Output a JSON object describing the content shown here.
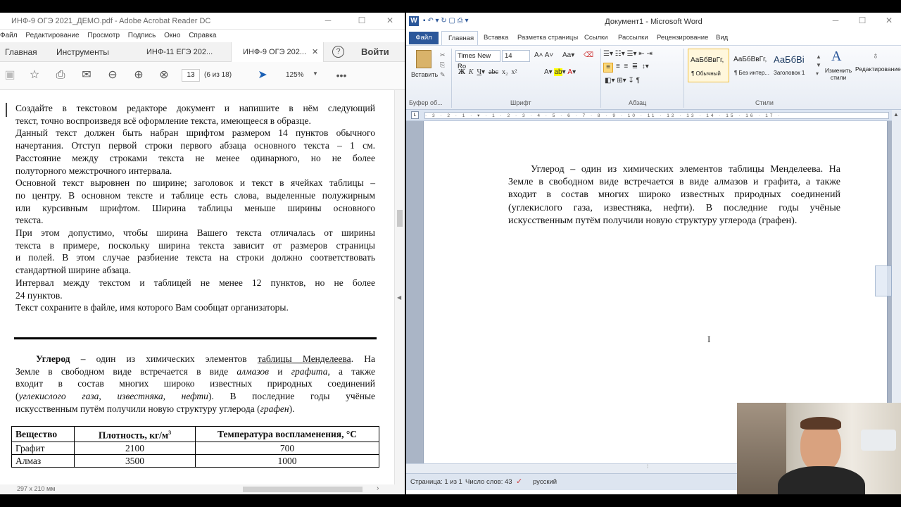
{
  "acrobat": {
    "title": "ИНФ-9 ОГЭ 2021_ДЕМО.pdf - Adobe Acrobat Reader DC",
    "menu": [
      "Файл",
      "Редактирование",
      "Просмотр",
      "Подпись",
      "Окно",
      "Справка"
    ],
    "tabs": {
      "home": "Главная",
      "tools": "Инструменты",
      "tab1": "ИНФ-11 ЕГЭ 202...",
      "tab2": "ИНФ-9 ОГЭ 202...",
      "signin": "Войти"
    },
    "toolbar": {
      "page_num": "13",
      "page_of": "(6 из 18)",
      "zoom": "125%"
    },
    "instructions": [
      "Создайте в текстовом редакторе документ и напишите в нём следующий",
      "текст, точно воспроизведя всё оформление текста, имеющееся в образце.",
      "Данный текст должен быть набран шрифтом размером 14 пунктов обычного",
      "начертания. Отступ первой строки первого абзаца основного текста – 1 см.",
      "Расстояние между строками текста не менее одинарного, но не более",
      "полуторного межстрочного интервала.",
      "Основной текст выровнен по ширине; заголовок и текст в ячейках таблицы –",
      "по центру. В основном тексте и таблице есть слова, выделенные полужирным",
      "или курсивным шрифтом. Ширина таблицы меньше ширины основного",
      "текста.",
      "При этом допустимо, чтобы ширина Вашего текста отличалась от ширины",
      "текста в примере, поскольку ширина текста зависит от размеров страницы",
      "и полей. В этом случае разбиение текста на строки должно соответствовать",
      "стандартной ширине абзаца.",
      "Интервал между текстом и таблицей не менее 12 пунктов, но не более",
      "24 пунктов.",
      "Текст сохраните в файле, имя которого Вам сообщат организаторы."
    ],
    "sample": {
      "w_uglerod": "Углерод",
      "t1": " – один из химических элементов ",
      "w_table": "таблицы Менделеева",
      "t2": ". На",
      "l2a": "Земле в свободном виде встречается в виде ",
      "w_almaz": "алмазов",
      "l2b": " и ",
      "w_grafit": "графита",
      "l2c": ", а также",
      "l3": "входит в состав многих широко известных природных соединений",
      "l4a": "(",
      "w_ugl": "углекислого газа",
      "l4b": ", ",
      "w_izv": "известняка",
      "l4c": ", ",
      "w_neft": "нефти",
      "l4d": "). В последние годы учёные",
      "l5a": "искусственным путём получили новую структуру углерода (",
      "w_grafen": "графен",
      "l5b": ")."
    },
    "table": {
      "headers": [
        "Вещество",
        "Плотность, кг/м",
        "Температура воспламенения, °С"
      ],
      "sup": "3",
      "rows": [
        [
          "Графит",
          "2100",
          "700"
        ],
        [
          "Алмаз",
          "3500",
          "1000"
        ]
      ]
    },
    "status": {
      "size": "297 x 210 мм"
    }
  },
  "word": {
    "title": "Документ1 - Microsoft Word",
    "tabs": [
      "Файл",
      "Главная",
      "Вставка",
      "Разметка страницы",
      "Ссылки",
      "Рассылки",
      "Рецензирование",
      "Вид"
    ],
    "ribbon": {
      "paste": "Вставить",
      "font": "Times New Ro",
      "size": "14",
      "styles": [
        {
          "preview": "АаБбВвГг,",
          "name": "¶ Обычный"
        },
        {
          "preview": "АаБбВвГг,",
          "name": "¶ Без интер..."
        },
        {
          "preview": "АаБбВі",
          "name": "Заголовок 1"
        }
      ],
      "change_styles": "Изменить стили",
      "editing": "Редактирование",
      "groups": {
        "clipboard": "Буфер об...",
        "font": "Шрифт",
        "paragraph": "Абзац",
        "styles": "Стили"
      }
    },
    "doc_lines": [
      "Углерод – один из химических элементов таблицы Менделеева. На",
      "Земле в свободном виде встречается в виде алмазов и графита, а также",
      "входит в состав многих широко известных природных соединений",
      "(углекислого газа, известняка, нефти). В последние годы учёные",
      "искусственным путём получили новую структуру углерода (графен)."
    ],
    "status": {
      "page": "Страница: 1 из 1",
      "words": "Число слов: 43",
      "lang": "русский"
    }
  }
}
